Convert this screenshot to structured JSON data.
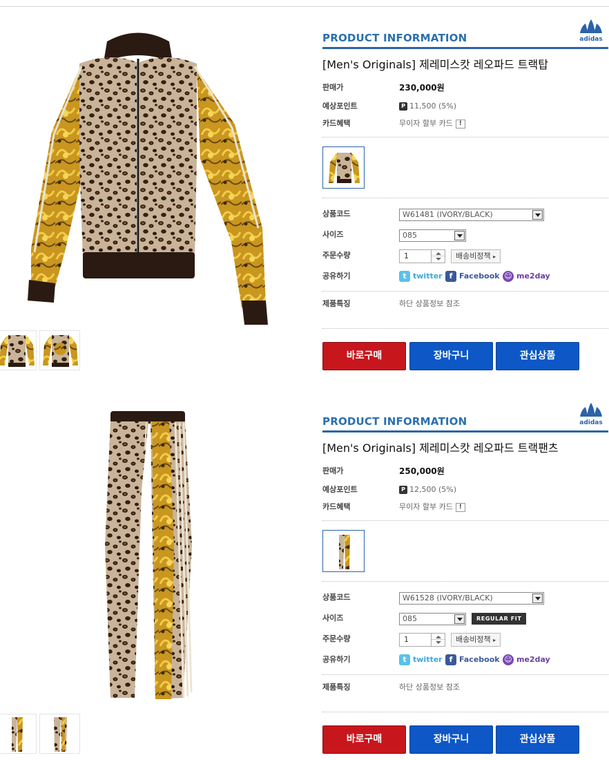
{
  "colors": {
    "brand_blue": "#2b63a8",
    "title_blue": "#2a6fb0",
    "buy_red": "#c8161d",
    "action_blue": "#0d57c6"
  },
  "products": [
    {
      "section_title": "PRODUCT INFORMATION",
      "logo_text": "adidas",
      "name": "[Men's Originals] 제레미스캇 레오파드 트랙탑",
      "price_label": "판매가",
      "price": "230,000원",
      "points_label": "예상포인트",
      "points": "11,500 (5%)",
      "points_badge": "P",
      "card_label": "카드혜택",
      "card_value": "무이자 할부 카드",
      "code_label": "상품코드",
      "code_value": "W61481 (IVORY/BLACK)",
      "size_label": "사이즈",
      "size_value": "085",
      "qty_label": "주문수량",
      "qty_value": "1",
      "shipping_button": "배송비정책",
      "share_label": "공유하기",
      "share_twitter": "twitter",
      "share_facebook": "Facebook",
      "share_me2day": "me2day",
      "feature_label": "제품특징",
      "feature_value": "하단 상품정보 참조",
      "buy_now": "바로구매",
      "cart": "장바구니",
      "wishlist": "관심상품",
      "icons": [
        "jacket-image",
        "twitter-icon",
        "facebook-icon",
        "me2day-icon",
        "adidas-logo-icon"
      ]
    },
    {
      "section_title": "PRODUCT INFORMATION",
      "logo_text": "adidas",
      "name": "[Men's Originals] 제레미스캇 레오파드 트랙팬츠",
      "price_label": "판매가",
      "price": "250,000원",
      "points_label": "예상포인트",
      "points": "12,500 (5%)",
      "points_badge": "P",
      "card_label": "카드혜택",
      "card_value": "무이자 할부 카드",
      "code_label": "상품코드",
      "code_value": "W61528 (IVORY/BLACK)",
      "size_label": "사이즈",
      "size_value": "085",
      "fit_badge": "REGULAR FIT",
      "qty_label": "주문수량",
      "qty_value": "1",
      "shipping_button": "배송비정책",
      "share_label": "공유하기",
      "share_twitter": "twitter",
      "share_facebook": "Facebook",
      "share_me2day": "me2day",
      "feature_label": "제품특징",
      "feature_value": "하단 상품정보 참조",
      "buy_now": "바로구매",
      "cart": "장바구니",
      "wishlist": "관심상품",
      "icons": [
        "pants-image",
        "twitter-icon",
        "facebook-icon",
        "me2day-icon",
        "adidas-logo-icon"
      ]
    }
  ]
}
